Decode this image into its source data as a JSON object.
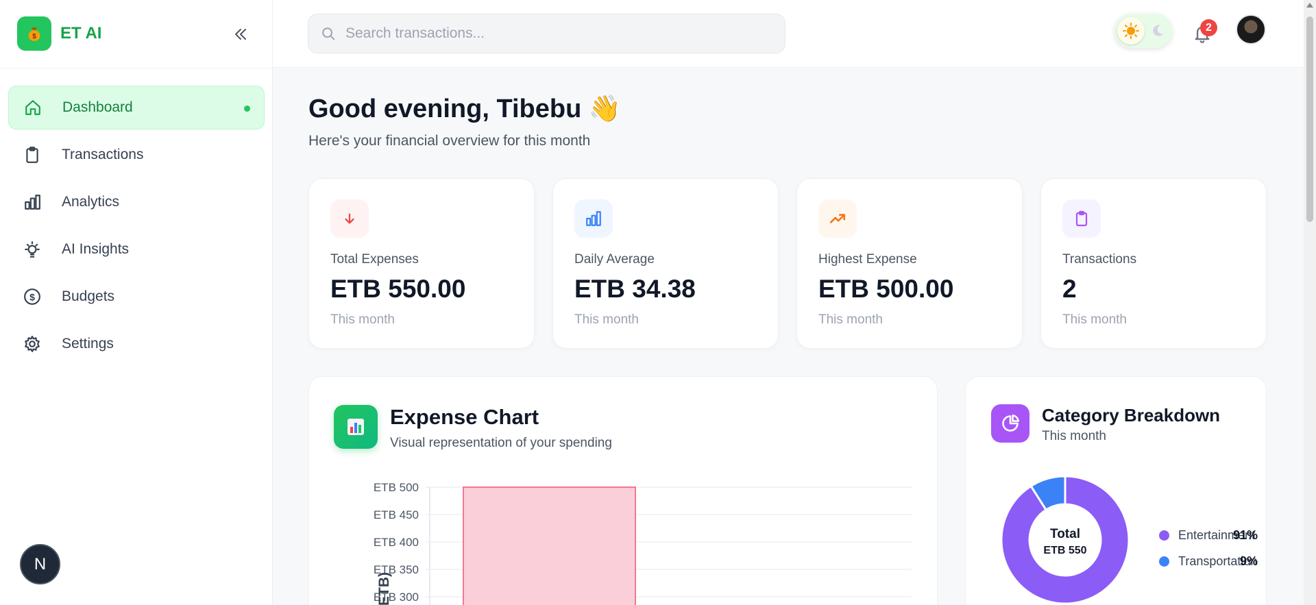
{
  "brand": {
    "name": "ET AI",
    "logo_icon": "money-bag-icon",
    "brand_color": "#16a34a"
  },
  "sidebar": {
    "items": [
      {
        "label": "Dashboard",
        "icon": "home-icon",
        "active": true
      },
      {
        "label": "Transactions",
        "icon": "clipboard-icon",
        "active": false
      },
      {
        "label": "Analytics",
        "icon": "bar-chart-icon",
        "active": false
      },
      {
        "label": "AI Insights",
        "icon": "lightbulb-icon",
        "active": false
      },
      {
        "label": "Budgets",
        "icon": "dollar-circle-icon",
        "active": false
      },
      {
        "label": "Settings",
        "icon": "gear-icon",
        "active": false
      }
    ],
    "footer_badge": "N"
  },
  "header": {
    "search_placeholder": "Search transactions...",
    "notification_count": "2",
    "theme": "light"
  },
  "main": {
    "greeting": "Good evening, Tibebu 👋",
    "subgreeting": "Here's your financial overview for this month",
    "stats": [
      {
        "label": "Total Expenses",
        "value": "ETB 550.00",
        "sub": "This month",
        "icon": "arrow-down-icon",
        "color": "#ef4444",
        "bg": "#fef2f2"
      },
      {
        "label": "Daily Average",
        "value": "ETB 34.38",
        "sub": "This month",
        "icon": "bar-chart-icon",
        "color": "#3b82f6",
        "bg": "#eff6ff"
      },
      {
        "label": "Highest Expense",
        "value": "ETB 500.00",
        "sub": "This month",
        "icon": "trending-up-icon",
        "color": "#f97316",
        "bg": "#fff7ed"
      },
      {
        "label": "Transactions",
        "value": "2",
        "sub": "This month",
        "icon": "clipboard-icon",
        "color": "#a855f7",
        "bg": "#faf5ff"
      }
    ]
  },
  "expense_chart": {
    "title": "Expense Chart",
    "subtitle": "Visual representation of your spending",
    "ylabel_visible_fragment": "ETB)"
  },
  "category_breakdown": {
    "title": "Category Breakdown",
    "subtitle": "This month",
    "center_label": "Total",
    "center_value": "ETB 550"
  },
  "chart_data": [
    {
      "type": "bar",
      "ytick_labels": [
        "ETB 500",
        "ETB 450",
        "ETB 400",
        "ETB 350",
        "ETB 300"
      ],
      "ylim": [
        300,
        500
      ],
      "series": [
        {
          "values": [
            500
          ],
          "color": "#fbcfd9",
          "border": "#f47690"
        }
      ],
      "grid": true
    },
    {
      "type": "pie",
      "donut": true,
      "categories": [
        "Entertainment",
        "Transportation"
      ],
      "values": [
        91,
        9
      ],
      "labels": [
        "91%",
        "9%"
      ],
      "colors": [
        "#8b5cf6",
        "#3b82f6"
      ]
    }
  ]
}
